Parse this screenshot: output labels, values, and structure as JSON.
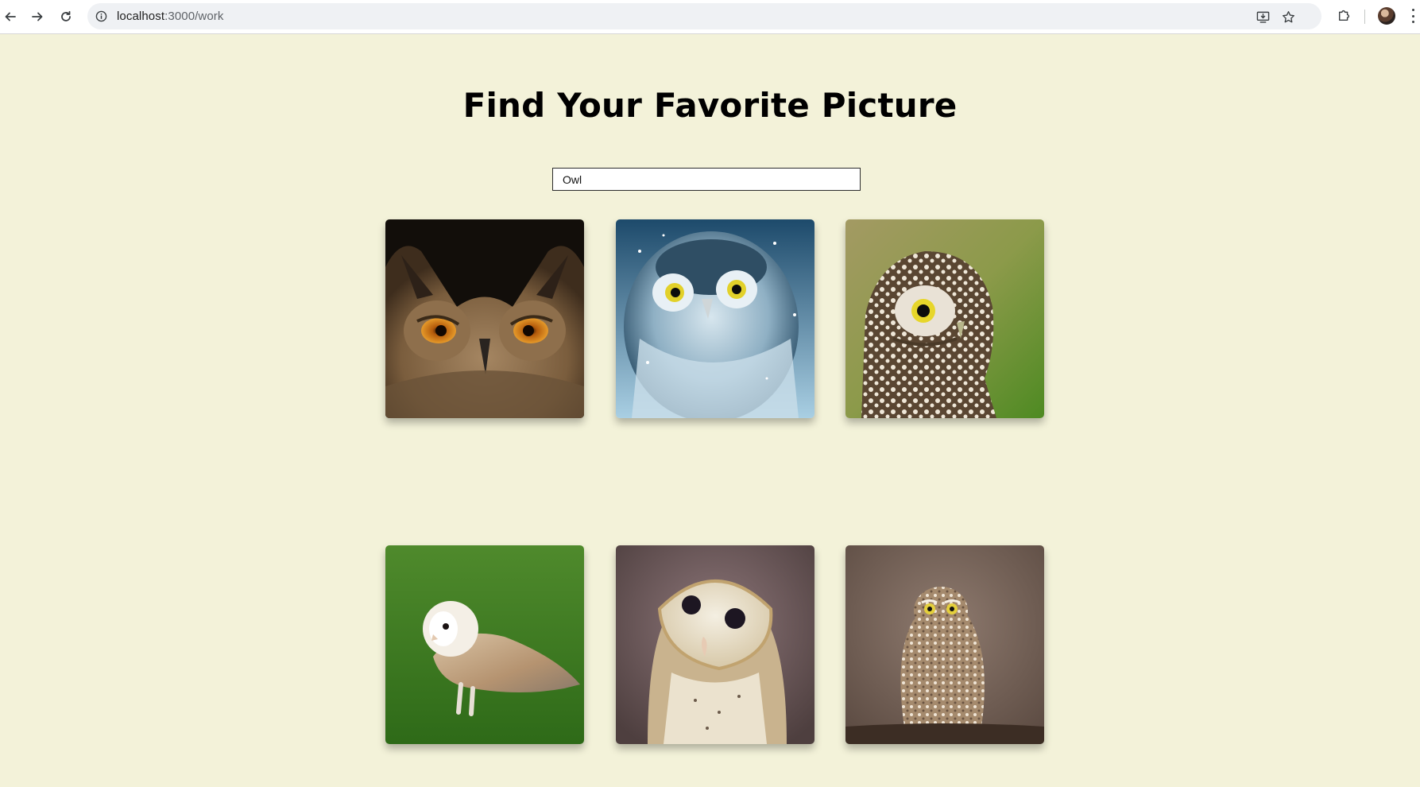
{
  "browser": {
    "url_host": "localhost",
    "url_path": ":3000/work",
    "icons": {
      "back": "arrow-left-icon",
      "forward": "arrow-right-icon",
      "reload": "reload-icon",
      "site_info": "info-icon",
      "install": "install-app-icon",
      "bookmark": "star-icon",
      "extensions": "puzzle-icon",
      "profile": "avatar",
      "menu": "kebab-menu-icon"
    }
  },
  "page": {
    "title": "Find Your Favorite Picture",
    "search_value": "Owl",
    "background_color": "#f3f2d9"
  },
  "gallery": {
    "items": [
      {
        "subject": "eagle-owl"
      },
      {
        "subject": "snowy-hawk-owl"
      },
      {
        "subject": "little-owl-green"
      },
      {
        "subject": "barn-owl-grass"
      },
      {
        "subject": "barn-owl-portrait"
      },
      {
        "subject": "burrowing-owl"
      }
    ]
  }
}
